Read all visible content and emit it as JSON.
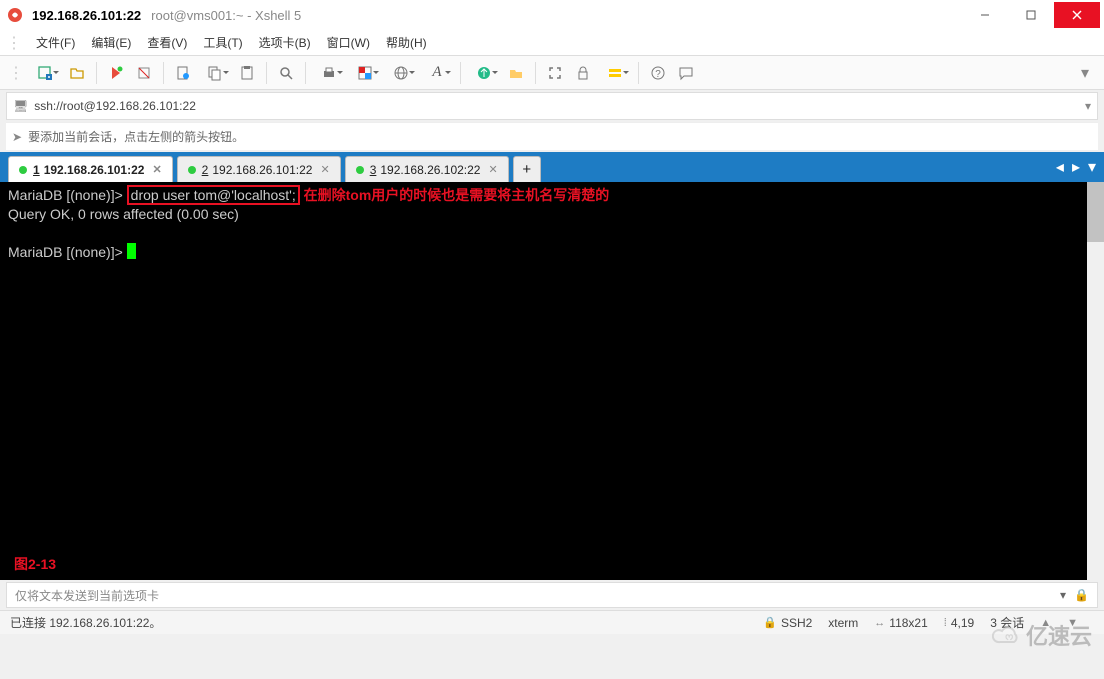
{
  "window": {
    "title_primary": "192.168.26.101:22",
    "title_secondary": "root@vms001:~ - Xshell 5"
  },
  "menu": {
    "file": "文件(F)",
    "edit": "编辑(E)",
    "view": "查看(V)",
    "tools": "工具(T)",
    "tabs": "选项卡(B)",
    "window": "窗口(W)",
    "help": "帮助(H)"
  },
  "address": {
    "url": "ssh://root@192.168.26.101:22"
  },
  "hint": {
    "text": "要添加当前会话，点击左侧的箭头按钮。"
  },
  "tabs": [
    {
      "num": "1",
      "label": "192.168.26.101:22",
      "active": true
    },
    {
      "num": "2",
      "label": "192.168.26.101:22",
      "active": false
    },
    {
      "num": "3",
      "label": "192.168.26.102:22",
      "active": false
    }
  ],
  "terminal": {
    "prompt": "MariaDB [(none)]>",
    "command": "drop user tom@'localhost';",
    "annotation": "在删除tom用户的时候也是需要将主机名写清楚的",
    "result": "Query OK, 0 rows affected (0.00 sec)",
    "figure_label": "图2-13"
  },
  "sendbar": {
    "placeholder": "仅将文本发送到当前选项卡"
  },
  "status": {
    "connection": "已连接 192.168.26.101:22。",
    "protocol": "SSH2",
    "term": "xterm",
    "size": "118x21",
    "cursor": "4,19",
    "sessions": "3 会话"
  },
  "watermark": "亿速云"
}
